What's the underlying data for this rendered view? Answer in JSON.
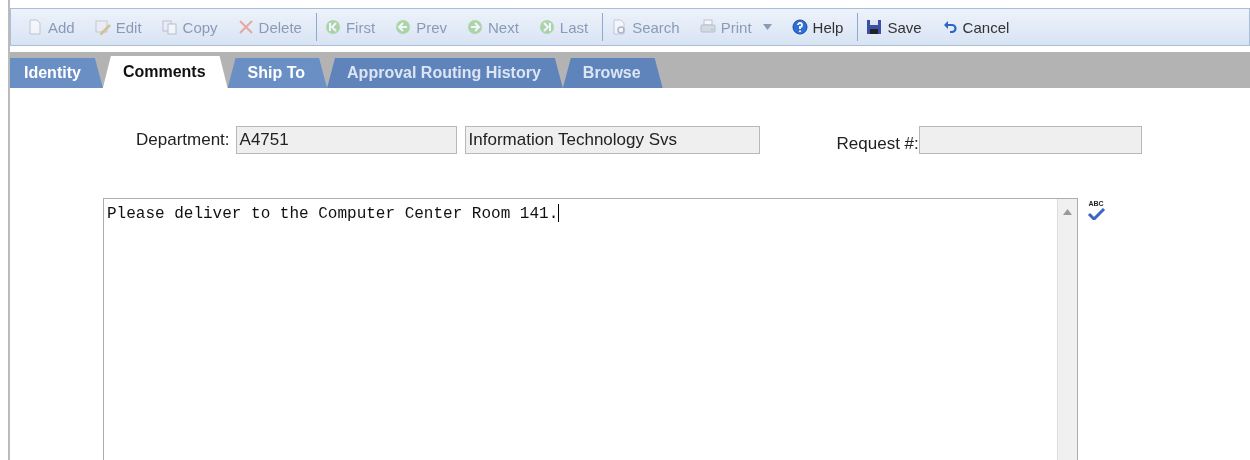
{
  "toolbar": {
    "groups": [
      [
        {
          "label": "Add",
          "kind": "add",
          "disabled": true
        },
        {
          "label": "Edit",
          "kind": "edit",
          "disabled": true
        },
        {
          "label": "Copy",
          "kind": "copy",
          "disabled": true
        },
        {
          "label": "Delete",
          "kind": "delete",
          "disabled": true
        }
      ],
      [
        {
          "label": "First",
          "kind": "first",
          "disabled": true
        },
        {
          "label": "Prev",
          "kind": "prev",
          "disabled": true
        },
        {
          "label": "Next",
          "kind": "next",
          "disabled": true
        },
        {
          "label": "Last",
          "kind": "last",
          "disabled": true
        }
      ],
      [
        {
          "label": "Search",
          "kind": "search",
          "disabled": true
        },
        {
          "label": "Print",
          "kind": "print",
          "disabled": true,
          "has_menu": true
        },
        {
          "label": "Help",
          "kind": "help",
          "disabled": false
        }
      ],
      [
        {
          "label": "Save",
          "kind": "save",
          "disabled": false
        },
        {
          "label": "Cancel",
          "kind": "cancel",
          "disabled": false
        }
      ]
    ]
  },
  "tabs": [
    {
      "label": "Identity",
      "selected": false,
      "disabled": false
    },
    {
      "label": "Comments",
      "selected": true,
      "disabled": false
    },
    {
      "label": "Ship To",
      "selected": false,
      "disabled": false
    },
    {
      "label": "Approval Routing History",
      "selected": false,
      "disabled": true
    },
    {
      "label": "Browse",
      "selected": false,
      "disabled": true
    }
  ],
  "form": {
    "department_label": "Department:",
    "department_code": "A4751",
    "department_name": "Information Technology Svs",
    "request_label": "Request #:"
  },
  "comments": {
    "value": "Please deliver to the Computer Center Room 141.",
    "spellcheck_label": "ABC"
  }
}
